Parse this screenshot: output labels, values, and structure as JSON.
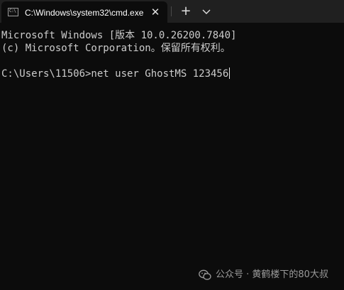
{
  "tab": {
    "title": "C:\\Windows\\system32\\cmd.exe",
    "icon": "cmd-prompt-icon",
    "close_glyph": "✕"
  },
  "tabbar": {
    "new_tab_glyph": "+",
    "dropdown_icon": "chevron-down-icon"
  },
  "terminal": {
    "lines": [
      "Microsoft Windows [版本 10.0.26200.7840]",
      "(c) Microsoft Corporation。保留所有权利。",
      "C:\\Users\\11506>net user GhostMS 123456"
    ]
  },
  "watermark": {
    "text": "公众号 · 黄鹤楼下的80大叔",
    "icon": "wechat-icon"
  },
  "colors": {
    "background": "#0c0c0c",
    "tabbar": "#202020",
    "text": "#cccccc"
  }
}
